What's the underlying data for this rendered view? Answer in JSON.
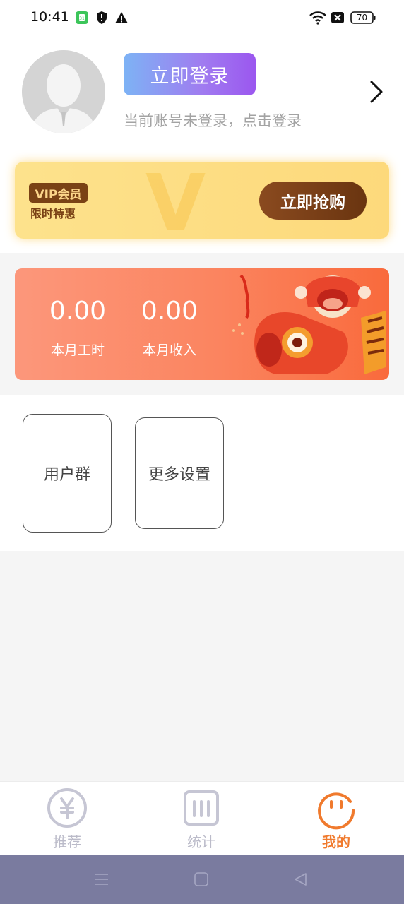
{
  "status_bar": {
    "time": "10:41",
    "battery": "70",
    "icons": [
      "app-notification-icon",
      "shield-icon",
      "warning-icon",
      "wifi-icon",
      "close-box-icon",
      "battery-icon"
    ]
  },
  "profile": {
    "login_button": "立即登录",
    "hint": "当前账号未登录，点击登录"
  },
  "vip": {
    "badge": "VIP会员",
    "subtitle": "限时特惠",
    "buy_button": "立即抢购"
  },
  "stats": {
    "hours_value": "0.00",
    "hours_label": "本月工时",
    "income_value": "0.00",
    "income_label": "本月收入"
  },
  "menu": {
    "items": [
      {
        "label": "用户群"
      },
      {
        "label": "更多设置"
      }
    ]
  },
  "tabs": [
    {
      "label": "推荐",
      "icon": "yen-icon",
      "active": false
    },
    {
      "label": "统计",
      "icon": "stats-icon",
      "active": false
    },
    {
      "label": "我的",
      "icon": "smile-face-icon",
      "active": true
    }
  ],
  "colors": {
    "active_tab": "#f07a2d",
    "inactive_tab": "#bbbbc9",
    "login_gradient_start": "#7db3f5",
    "login_gradient_end": "#9b57ef",
    "vip_background": "#fde28c",
    "vip_button": "#7a4215",
    "stats_gradient_start": "#fc977b",
    "stats_gradient_end": "#f96a3c",
    "nav_bar": "#7a7b9f"
  }
}
